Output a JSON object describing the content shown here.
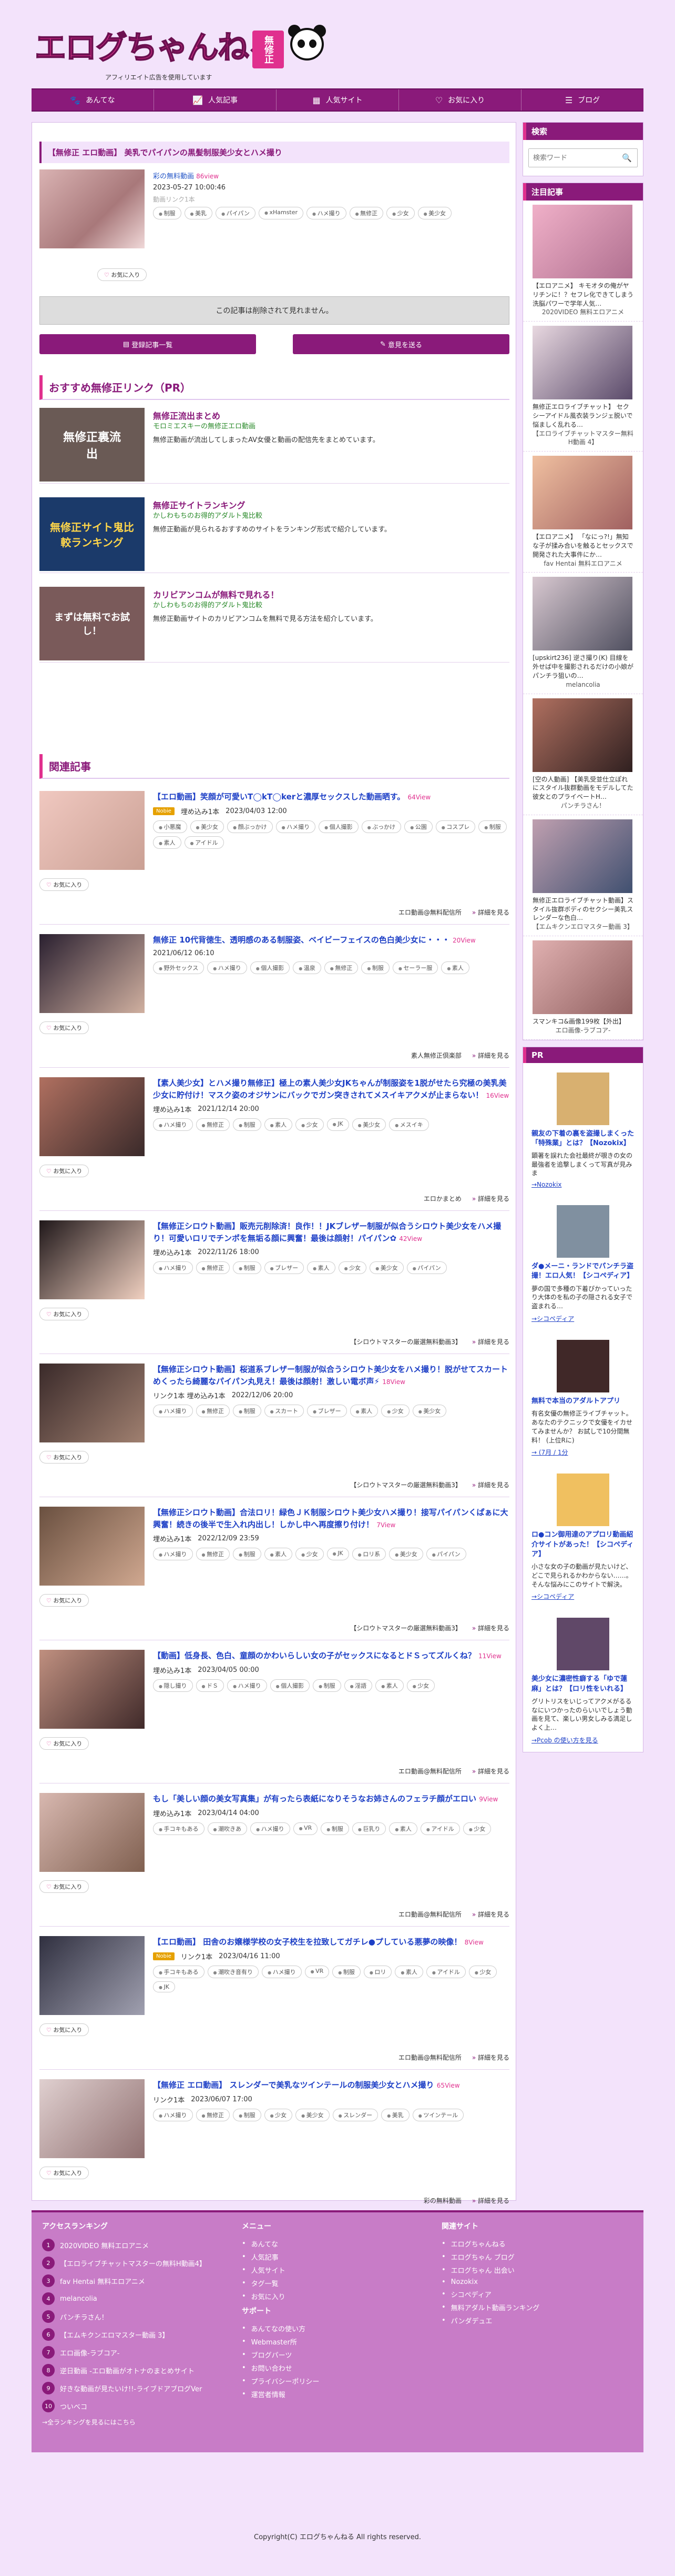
{
  "header": {
    "logo_text": "エログちゃんねる",
    "logo_badge": "無修正",
    "tagline": "アフィリエイト広告を使用しています"
  },
  "nav": [
    {
      "label": "あんてな",
      "icon": "paw-icon"
    },
    {
      "label": "人気記事",
      "icon": "chart-icon"
    },
    {
      "label": "人気サイト",
      "icon": "shop-icon"
    },
    {
      "label": "お気に入り",
      "icon": "heart-icon"
    },
    {
      "label": "ブログ",
      "icon": "list-icon"
    }
  ],
  "article": {
    "title": "【無修正 エロ動画】 美乳でパイパンの黒髪制服美少女とハメ撮り",
    "source": "彩の無料動画",
    "views": "86view",
    "date": "2023-05-27 10:00:46",
    "sub": "動画リンク1本",
    "tags": [
      "制服",
      "美乳",
      "パイパン",
      "xHamster",
      "ハメ撮り",
      "無修正",
      "少女",
      "美少女"
    ],
    "fav": "お気に入り",
    "deleted": "この記事は削除されて見れません。",
    "btn_list": "登録記事一覧",
    "btn_report": "意見を送る"
  },
  "pr_section": {
    "heading": "おすすめ無修正リンク（PR）",
    "items": [
      {
        "title": "無修正流出まとめ",
        "sub": "モロミエスキーの無修正エロ動画",
        "desc": "無修正動画が流出してしまったAV女優と動画の配信先をまとめています。",
        "thumb_text": "無修正裏流出"
      },
      {
        "title": "無修正サイトランキング",
        "sub": "かしわもちのお得的アダルト鬼比較",
        "desc": "無修正動画が見られるおすすめのサイトをランキング形式で紹介しています。",
        "thumb_text": "無修正サイト鬼比較ランキング"
      },
      {
        "title": "カリビアンコムが無料で見れる！",
        "sub": "かしわもちのお得的アダルト鬼比較",
        "desc": "無修正動画サイトのカリビアンコムを無料で見る方法を紹介しています。",
        "thumb_text": "まずは無料でお試し！"
      }
    ]
  },
  "related": {
    "heading": "関連記事",
    "items": [
      {
        "title": "【エロ動画】笑顔が可愛いT◯kT◯kerと濃厚セックスした動画晒す。",
        "views": "64View",
        "badge": "Nobie",
        "links": "埋め込み1本",
        "date": "2023/04/03 12:00",
        "tags": [
          "小悪魔",
          "美少女",
          "顔ぶっかけ",
          "ハメ撮り",
          "個人撮影",
          "ぶっかけ",
          "公園",
          "コスプレ",
          "制服",
          "素人",
          "アイドル"
        ],
        "src": "エロ動画@無料配信所",
        "more": "詳細を見る"
      },
      {
        "title": "無修正 10代背徳生、透明感のある制服姿、ベイビーフェイスの色白美少女に・・・",
        "views": "20View",
        "links": "",
        "date": "2021/06/12 06:10",
        "tags": [
          "野外セックス",
          "ハメ撮り",
          "個人撮影",
          "温泉",
          "無修正",
          "制服",
          "セーラー服",
          "素人"
        ],
        "src": "素人無修正倶楽部",
        "more": "詳細を見る"
      },
      {
        "title": "【素人美少女】とハメ撮り無修正】極上の素人美少女JKちゃんが制服姿を1脱がせたら究極の美乳美少女に貯付け！マスク姿のオジサンにバックでガン突きされてメスイキアクメが止まらない！",
        "views": "16View",
        "links": "埋め込み1本",
        "date": "2021/12/14 20:00",
        "tags": [
          "ハメ撮り",
          "無修正",
          "制服",
          "素人",
          "少女",
          "JK",
          "美少女",
          "メスイキ"
        ],
        "src": "エロかまとめ",
        "more": "詳細を見る"
      },
      {
        "title": "【無修正シロウト動画】販売元削除済！良作！！JKブレザー制服が似合うシロウト美少女をハメ撮り！可愛いロリでチンポを無垢る顔に興奮！最後は顔射！パイパン✿",
        "views": "42View",
        "links": "埋め込み1本",
        "date": "2022/11/26 18:00",
        "tags": [
          "ハメ撮り",
          "無修正",
          "制服",
          "ブレザー",
          "素人",
          "少女",
          "美少女",
          "パイパン"
        ],
        "src": "【シロウトマスターの厳選無料動画3】",
        "more": "詳細を見る"
      },
      {
        "title": "【無修正シロウト動画】桜道系ブレザー制服が似合うシロウト美少女をハメ撮り！脱がせてスカートめくったら綺麗なパイパン丸見え！最後は顔射！激しい電ボ声⚡",
        "views": "18View",
        "links": "リンク1本 埋め込み1本",
        "date": "2022/12/06 20:00",
        "tags": [
          "ハメ撮り",
          "無修正",
          "制服",
          "スカート",
          "ブレザー",
          "素人",
          "少女",
          "美少女"
        ],
        "src": "【シロウトマスターの厳選無料動画3】",
        "more": "詳細を見る"
      },
      {
        "title": "【無修正シロウト動画】合法ロリ！緑色ＪＫ制服シロウト美少女ハメ撮り！接写パイパンくぱぁに大興奮！続きの後半で生入れ内出し！しかし中へ再度擦り付け！ ",
        "views": "7View",
        "links": "埋め込み1本",
        "date": "2022/12/09 23:59",
        "tags": [
          "ハメ撮り",
          "無修正",
          "制服",
          "素人",
          "少女",
          "JK",
          "ロリ系",
          "美少女",
          "パイパン"
        ],
        "src": "【シロウトマスターの厳選無料動画3】",
        "more": "詳細を見る"
      },
      {
        "title": "【動画】低身長、色白、童顔のかわいらしい女の子がセックスになるとドＳってズルくね？",
        "views": "11View",
        "links": "埋め込み1本",
        "date": "2023/04/05 00:00",
        "tags": [
          "隠し撮り",
          "ドＳ",
          "ハメ撮り",
          "個人撮影",
          "制服",
          "淫語",
          "素人",
          "少女"
        ],
        "src": "エロ動画@無料配信所",
        "more": "詳細を見る"
      },
      {
        "title": "もし「美しい顔の美女写真集」が有ったら表紙になりそうなお姉さんのフェラチ顔がエロい",
        "views": "9View",
        "links": "埋め込み1本",
        "date": "2023/04/14 04:00",
        "tags": [
          "手コキもある",
          "潮吹きあ",
          "ハメ撮り",
          "VR",
          "制服",
          "巨乳り",
          "素人",
          "アイドル",
          "少女"
        ],
        "src": "エロ動画@無料配信所",
        "more": "詳細を見る"
      },
      {
        "title": "【エロ動画】 田舎のお嬢様学校の女子校生を拉致してガチレ●プしている悪夢の映像！",
        "views": "8View",
        "badge": "Nobie",
        "links": "リンク1本",
        "date": "2023/04/16 11:00",
        "tags": [
          "手コキもある",
          "潮吹き音有り",
          "ハメ撮り",
          "VR",
          "制服",
          "ロリ",
          "素人",
          "アイドル",
          "少女",
          "JK"
        ],
        "src": "エロ動画@無料配信所",
        "more": "詳細を見る"
      },
      {
        "title": "【無修正 エロ動画】 スレンダーで美乳なツインテールの制服美少女とハメ撮り",
        "views": "65View",
        "links": "リンク1本",
        "date": "2023/06/07 17:00",
        "tags": [
          "ハメ撮り",
          "無修正",
          "制服",
          "少女",
          "美少女",
          "スレンダー",
          "美乳",
          "ツインテール"
        ],
        "src": "彩の無料動画",
        "more": "詳細を見る"
      }
    ]
  },
  "sidebar": {
    "search_heading": "検索",
    "search_placeholder": "検索ワード",
    "featured_heading": "注目記事",
    "featured": [
      {
        "cap": "【エロアニメ】 キモオタの俺がヤリチンに！？セフレ化できてしまう洗脳パワーで学年人気…",
        "src": "2020VIDEO 無料エロアニメ"
      },
      {
        "cap": "無修正エロライブチャット】 セクシーアイドル風衣装ランジェ脱いで悩ましく乱れる…",
        "src": "【エロライブチャットマスター無料H動画 4】"
      },
      {
        "cap": "【エロアニメ】 「なにっ?!」無知な子が揉み合いを触るとセックスで開発された大事件にか…",
        "src": "fav Hentai 無料エロアニメ"
      },
      {
        "cap": "[upskirt236] 逆さ撮り(K) 目線を外せば中を撮影されるだけの小娘がパンチラ狙いの…",
        "src": "melancolia"
      },
      {
        "cap": "[空の人動画] 【美乳受並仕立ぽれにスタイル抜群動画をモデルしてた彼女とのプライベートH…",
        "src": "パンチラさん！"
      },
      {
        "cap": "無修正エロライブチャット動画】スタイル抜群ボディのセクシー美乳スレンダーな色白…",
        "src": "【エムキクンエロマスター動画 3】"
      },
      {
        "cap": "スマンキコ&画像199枚【外出】",
        "src": "エロ画像-ラブコア-"
      }
    ],
    "pr_heading": "PR",
    "pr": [
      {
        "title": "親友の下着の裏を盗撮しまくった「特殊業」とは？【Nozokix】",
        "desc": "顕著を誤れた会社最終が覗きの女の最強者を追撃しまくって写真が見みま",
        "link": "→Nozokix"
      },
      {
        "title": "ダ●メーニ・ランドでパンチラ盗撮！エロ人気！【シコペディア】",
        "desc": "夢の国で多種の下着ぴかっていったり大体のを私の子の隠される女子で盗まれる…",
        "link": "→シコペディア"
      },
      {
        "title": "無料で本当のアダルトアプリ",
        "desc": "有名女優の無修正ライブチャット。あなたのテクニックで女優をイカせてみませんか？ お試しで10分間無料！ (上位Rに)",
        "link": "→ (7月 / 1分"
      },
      {
        "title": "ロ●コン御用達のアプロリ動画紹介サイトがあった！【シコペディア】",
        "desc": "小さな女の子の動画が見たいけど、どこで見られるかわからない……。そんな悩みにこのサイトで解決。",
        "link": "→シコペディア"
      },
      {
        "title": "美少女に濃密性癖する「ゆで蓮麻」とは？【ロリ性をいれる】",
        "desc": "グリトリスをいじってアクメがるるなにいつかったのらいいでしょう動画を見て、楽しい男女しみる満足しよく上…",
        "link": "→Pcob の使い方を見る"
      }
    ]
  },
  "footer": {
    "access_heading": "アクセスランキング",
    "access": [
      "2020VIDEO 無料エロアニメ",
      "【エロライブチャットマスターの無料H動画4】",
      "fav Hentai 無料エロアニメ",
      "melancolia",
      "パンチラさん！",
      "【エムキクンエロマスター動画 3】",
      "エロ画像-ラブコア-",
      "逆日動画 -エロ動画がオトナのまとめサイト",
      "好きな動画が見たいけ!!-ライブドアブログVer",
      "ついべコ"
    ],
    "access_more": "→全ランキングを見るにはこちら",
    "menu_heading": "メニュー",
    "menu": [
      "あんてな",
      "人気記事",
      "人気サイト",
      "タグ一覧",
      "お気に入り"
    ],
    "support_heading": "サポート",
    "support": [
      "あんてなの使い方",
      "Webmaster所",
      "ブログパーツ",
      "お問い合わせ",
      "プライバシーポリシー",
      "運営者情報"
    ],
    "links_heading": "関連サイト",
    "links": [
      "エログちゃんねる",
      "エログちゃん ブログ",
      "エログちゃん 出会い",
      "Nozokix",
      "シコペディア",
      "無料アダルト動画ランキング",
      "パンダデュエ"
    ],
    "copyright": "Copyright(C) エログちゃんねる All rights reserved."
  }
}
